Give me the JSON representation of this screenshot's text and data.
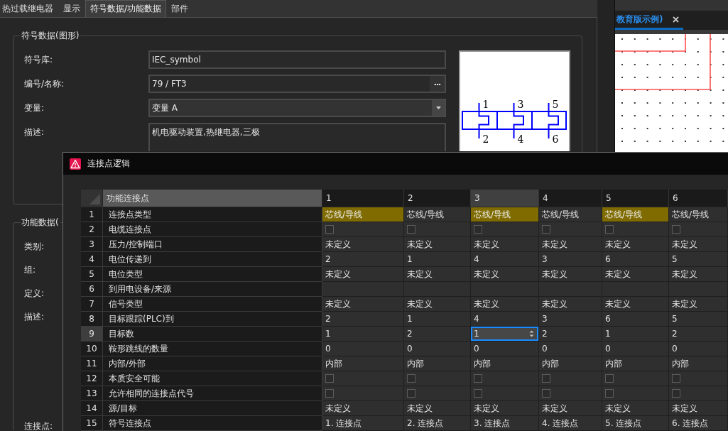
{
  "main_window": {
    "tabs": [
      {
        "label": "热过载继电器",
        "selected": false
      },
      {
        "label": "显示",
        "selected": false
      },
      {
        "label": "符号数据/功能数据",
        "selected": true
      },
      {
        "label": "部件",
        "selected": false
      }
    ],
    "symbol_group": {
      "title": "符号数据(图形)",
      "fields": [
        {
          "kind": "text",
          "label": "符号库:",
          "value": "IEC_symbol"
        },
        {
          "kind": "browse",
          "label": "编号/名称:",
          "value": "79 / FT3",
          "button": "..."
        },
        {
          "kind": "dropdown",
          "label": "变量:",
          "value": "变量 A"
        },
        {
          "kind": "textarea",
          "label": "描述:",
          "value": "机电驱动装置,热继电器,三极"
        }
      ],
      "preview": {
        "pins": [
          "1",
          "2",
          "3",
          "4",
          "5",
          "6"
        ]
      }
    },
    "function_group": {
      "title": "功能数据(",
      "labels": [
        "类别:",
        "组:",
        "定义:",
        "描述:",
        "连接点:"
      ]
    }
  },
  "editor": {
    "tab": {
      "label": "教育版示例)",
      "selected": true
    }
  },
  "dialog": {
    "title": "连接点逻辑",
    "table": {
      "header": "功能连接点",
      "columns": [
        {
          "label": "1",
          "selected": false
        },
        {
          "label": "2",
          "selected": false
        },
        {
          "label": "3",
          "selected": true
        },
        {
          "label": "4",
          "selected": false
        },
        {
          "label": "5",
          "selected": false
        },
        {
          "label": "6",
          "selected": false
        }
      ],
      "rows": [
        {
          "number": "1",
          "label": "连接点类型",
          "selected": false,
          "kind": "text",
          "cells": [
            {
              "value": "芯线/导线",
              "highlighted": true
            },
            {
              "value": "芯线/导线",
              "highlighted": false
            },
            {
              "value": "芯线/导线",
              "highlighted": true
            },
            {
              "value": "芯线/导线",
              "highlighted": false
            },
            {
              "value": "芯线/导线",
              "highlighted": true
            },
            {
              "value": "芯线/导线",
              "highlighted": false
            }
          ]
        },
        {
          "number": "2",
          "label": "电缆连接点",
          "selected": false,
          "kind": "checkbox",
          "cells": [
            {
              "checked": false
            },
            {
              "checked": false
            },
            {
              "checked": false
            },
            {
              "checked": false
            },
            {
              "checked": false
            },
            {
              "checked": false
            }
          ]
        },
        {
          "number": "3",
          "label": "压力/控制端口",
          "selected": false,
          "kind": "text",
          "cells": [
            {
              "value": "未定义"
            },
            {
              "value": "未定义"
            },
            {
              "value": "未定义"
            },
            {
              "value": "未定义"
            },
            {
              "value": "未定义"
            },
            {
              "value": "未定义"
            }
          ]
        },
        {
          "number": "4",
          "label": "电位传递到",
          "selected": false,
          "kind": "text",
          "cells": [
            {
              "value": "2"
            },
            {
              "value": "1"
            },
            {
              "value": "4"
            },
            {
              "value": "3"
            },
            {
              "value": "6"
            },
            {
              "value": "5"
            }
          ]
        },
        {
          "number": "5",
          "label": "电位类型",
          "selected": false,
          "kind": "text",
          "cells": [
            {
              "value": "未定义"
            },
            {
              "value": "未定义"
            },
            {
              "value": "未定义"
            },
            {
              "value": "未定义"
            },
            {
              "value": "未定义"
            },
            {
              "value": "未定义"
            }
          ]
        },
        {
          "number": "6",
          "label": "到用电设备/来源",
          "selected": false,
          "kind": "empty"
        },
        {
          "number": "7",
          "label": "信号类型",
          "selected": false,
          "kind": "text",
          "cells": [
            {
              "value": "未定义"
            },
            {
              "value": "未定义"
            },
            {
              "value": "未定义"
            },
            {
              "value": "未定义"
            },
            {
              "value": "未定义"
            },
            {
              "value": "未定义"
            }
          ]
        },
        {
          "number": "8",
          "label": "目标跟踪(PLC)到",
          "selected": false,
          "kind": "text",
          "cells": [
            {
              "value": "2"
            },
            {
              "value": "1"
            },
            {
              "value": "4"
            },
            {
              "value": "3"
            },
            {
              "value": "6"
            },
            {
              "value": "5"
            }
          ]
        },
        {
          "number": "9",
          "label": "目标数",
          "selected": true,
          "kind": "text",
          "cells": [
            {
              "value": "1",
              "editing": false
            },
            {
              "value": "2",
              "editing": false
            },
            {
              "value": "1",
              "editing": true
            },
            {
              "value": "2",
              "editing": false
            },
            {
              "value": "1",
              "editing": false
            },
            {
              "value": "2",
              "editing": false
            }
          ]
        },
        {
          "number": "10",
          "label": "鞍形跳线的数量",
          "selected": false,
          "kind": "text",
          "cells": [
            {
              "value": "0"
            },
            {
              "value": "0"
            },
            {
              "value": "0"
            },
            {
              "value": "0"
            },
            {
              "value": "0"
            },
            {
              "value": "0"
            }
          ]
        },
        {
          "number": "11",
          "label": "内部/外部",
          "selected": false,
          "kind": "text",
          "cells": [
            {
              "value": "内部"
            },
            {
              "value": "内部"
            },
            {
              "value": "内部"
            },
            {
              "value": "内部"
            },
            {
              "value": "内部"
            },
            {
              "value": "内部"
            }
          ]
        },
        {
          "number": "12",
          "label": "本质安全可能",
          "selected": false,
          "kind": "checkbox",
          "cells": [
            {
              "checked": false
            },
            {
              "checked": false
            },
            {
              "checked": false
            },
            {
              "checked": false
            },
            {
              "checked": false
            },
            {
              "checked": false
            }
          ]
        },
        {
          "number": "13",
          "label": "允许相同的连接点代号",
          "selected": false,
          "kind": "checkbox",
          "cells": [
            {
              "checked": false
            },
            {
              "checked": false
            },
            {
              "checked": false
            },
            {
              "checked": false
            },
            {
              "checked": false
            },
            {
              "checked": false
            }
          ]
        },
        {
          "number": "14",
          "label": "源/目标",
          "selected": false,
          "kind": "text",
          "cells": [
            {
              "value": "未定义"
            },
            {
              "value": "未定义"
            },
            {
              "value": "未定义"
            },
            {
              "value": "未定义"
            },
            {
              "value": "未定义"
            },
            {
              "value": "未定义"
            }
          ]
        },
        {
          "number": "15",
          "label": "符号连接点",
          "selected": false,
          "kind": "text",
          "cells": [
            {
              "value": "1. 连接点"
            },
            {
              "value": "2. 连接点"
            },
            {
              "value": "3. 连接点"
            },
            {
              "value": "4. 连接点"
            },
            {
              "value": "5. 连接点"
            },
            {
              "value": "6. 连接点"
            }
          ]
        }
      ]
    }
  }
}
